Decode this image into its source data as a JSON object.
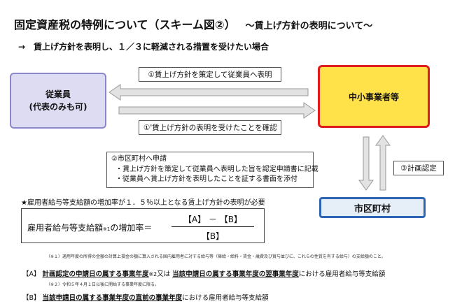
{
  "title": "固定資産税の特例について（スキーム図②）",
  "title_suffix": "～賃上げ方針の表明について～",
  "subtitle": "→　賃上げ方針を表明し、１／３に軽減される措置を受けたい場合",
  "nodes": {
    "employee": {
      "line1": "従業員",
      "line2": "(代表のみも可)"
    },
    "company": {
      "label": "中小事業者等"
    },
    "city": {
      "label": "市区町村"
    }
  },
  "steps": {
    "step1": "①賃上げ方針を策定して従業員へ表明",
    "step1_confirm": "①'賃上げ方針の表明を受けたことを確認",
    "step2_title": "②市区町村へ申請",
    "step2_items": [
      "・賃上げ方針を策定して従業員へ表明した旨を認定申請書に記載",
      "・従業員へ賃上げ方針を表明したことを証する書面を添付"
    ],
    "step3": "③計画認定"
  },
  "condition": "★雇用者給与等支給額の増加率が１．５％以上となる賃上げ方針の表明が必要",
  "formula": {
    "label": "雇用者給与等支給額",
    "note_mark": "※1",
    "label_tail": "の増加率＝",
    "numerator": "【A】 － 【B】",
    "denominator": "【B】"
  },
  "notes": {
    "n1": "（※１）適用年度の所得の金額の計算上損金の額に算入される国内雇用者に対する給与等（俸給・給料・賃金・歳費及び賞与並びに、これらの性質を有する給与）の支給額のこと。",
    "n2": "（※２）令和５年４月１日以後に開始する事業年度に限る。"
  },
  "definitions": {
    "a_prefix": "【A】",
    "a_part1": "計画認定の申請日の属する事業年度",
    "a_mark": "※2",
    "a_mid": "又は",
    "a_part2": "当該申請日の属する事業年度の翌事業年度",
    "a_tail": "における雇用者給与等支給額",
    "b_prefix": "【B】",
    "b_part1": "当該申請日の属する事業年度の直前の事業年度",
    "b_tail": "における雇用者給与等支給額"
  },
  "colors": {
    "employee_fill": "#dedcf2",
    "company_fill": "#ffe14a",
    "company_border": "#e01b1b",
    "city_border": "#2f65b5",
    "arrow_fill": "#e2e2e2"
  }
}
